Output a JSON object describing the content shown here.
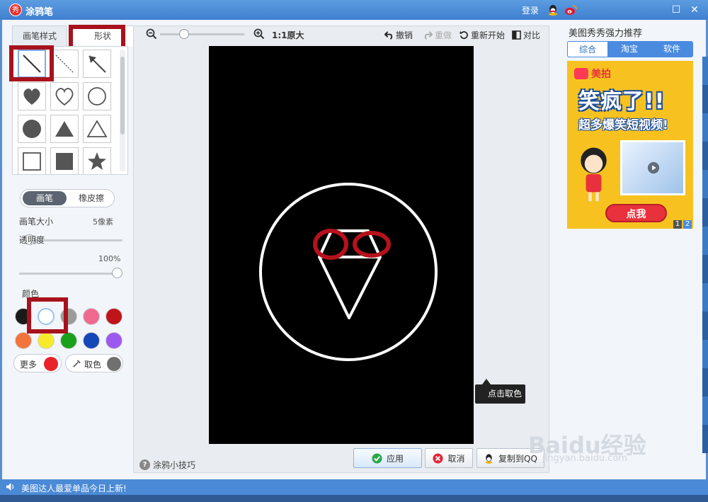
{
  "window": {
    "logo_text": "秀",
    "title": "涂鸦笔",
    "login": "登录",
    "maximize": "☐",
    "close": "✕"
  },
  "left": {
    "tabs": [
      {
        "label": "画笔样式"
      },
      {
        "label": "形状"
      }
    ],
    "shapes": [
      "line",
      "dashed-line",
      "arrow",
      "heart-filled",
      "heart-outline",
      "circle-outline",
      "circle-filled",
      "triangle-filled",
      "triangle-outline",
      "square-outline",
      "square-filled",
      "star-filled"
    ],
    "mode": {
      "brush": "画笔",
      "eraser": "橡皮擦"
    },
    "size": {
      "label": "画笔大小",
      "value": "5像素",
      "level": 0.05
    },
    "opacity": {
      "label": "透明度",
      "value": "100%",
      "level": 1.0
    },
    "color_label": "颜色",
    "colors": [
      "#1a1a1a",
      "#ffffff",
      "#9a9a9a",
      "#f06a8f",
      "#c0141b",
      "#f2743c",
      "#f7ea2a",
      "#1aa11a",
      "#1447b8",
      "#9b59f0"
    ],
    "more": {
      "label": "更多",
      "color": "#e8232a"
    },
    "pick": {
      "label": "取色",
      "color": "#707070"
    }
  },
  "toolbar": {
    "zoom_text": "1:1原大",
    "undo": "撤销",
    "redo": "重做",
    "restart": "重新开始",
    "compare": "对比"
  },
  "canvas": {
    "tooltip": "点击取色"
  },
  "footer": {
    "tips": "涂鸦小技巧",
    "apply": "应用",
    "cancel": "取消",
    "copy": "复制到QQ"
  },
  "promo": {
    "title": "美图秀秀强力推荐",
    "tabs": [
      "综合",
      "淘宝",
      "软件"
    ],
    "ad_logo": "美拍",
    "ad_headline": "笑疯了!!",
    "ad_sub": "超多爆笑短视频!",
    "ad_cta": "点我",
    "pages": [
      "1",
      "2"
    ]
  },
  "status": {
    "text": "美图达人最爱单品今日上新!"
  },
  "watermark": {
    "brand": "Baidu经验",
    "url": "jingyan.baidu.com"
  }
}
